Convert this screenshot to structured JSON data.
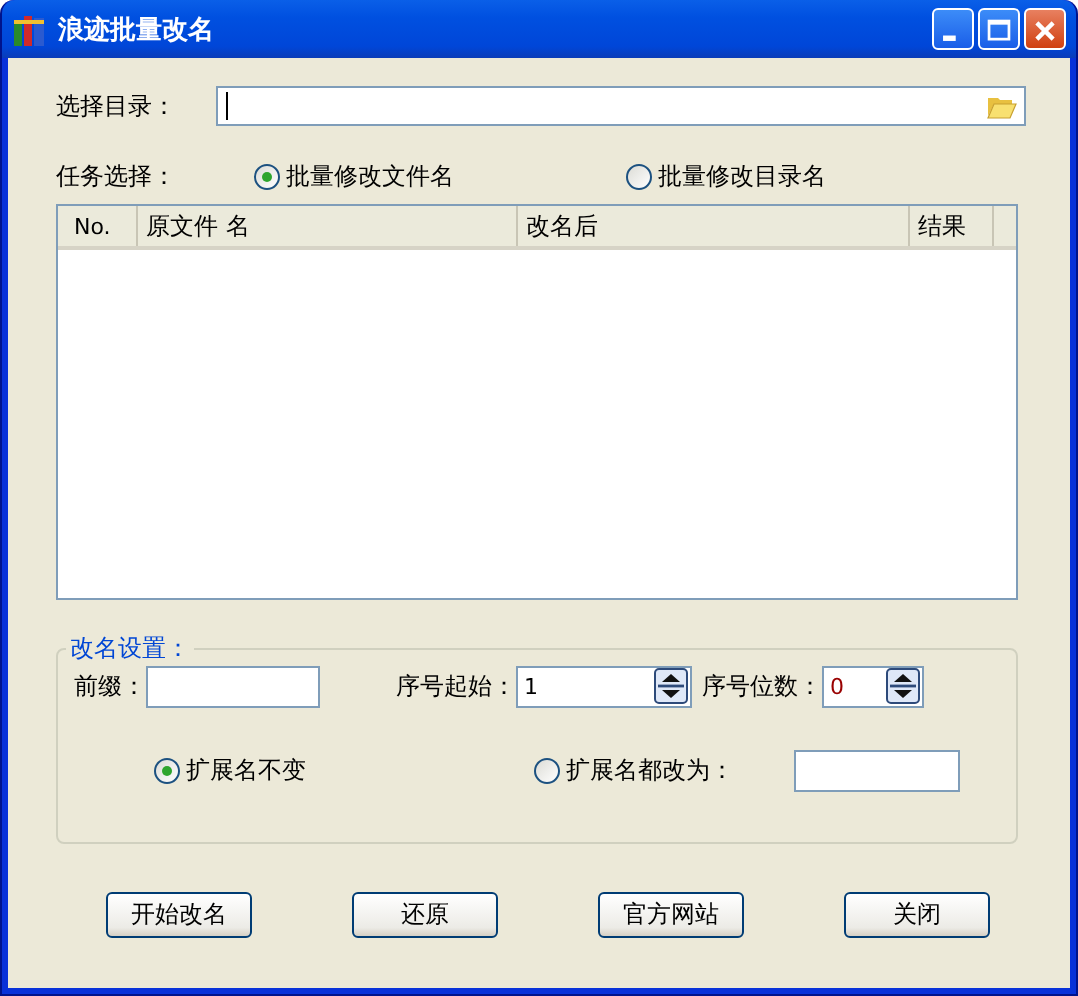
{
  "window": {
    "title": "浪迹批量改名"
  },
  "directory": {
    "label": "选择目录："
  },
  "task": {
    "label": "任务选择：",
    "options": [
      {
        "label": "批量修改文件名",
        "selected": true
      },
      {
        "label": "批量修改目录名",
        "selected": false
      }
    ]
  },
  "table": {
    "columns": [
      "No.",
      "原文件 名",
      "改名后",
      "结果"
    ]
  },
  "settings": {
    "title": "改名设置：",
    "prefix": {
      "label": "前缀："
    },
    "start": {
      "label": "序号起始：",
      "value": "1"
    },
    "digits": {
      "label": "序号位数：",
      "value": "0"
    },
    "extension_options": [
      {
        "label": "扩展名不变",
        "selected": true
      },
      {
        "label": "扩展名都改为：",
        "selected": false
      }
    ]
  },
  "buttons": [
    "开始改名",
    "还原",
    "官方网站",
    "关闭"
  ]
}
